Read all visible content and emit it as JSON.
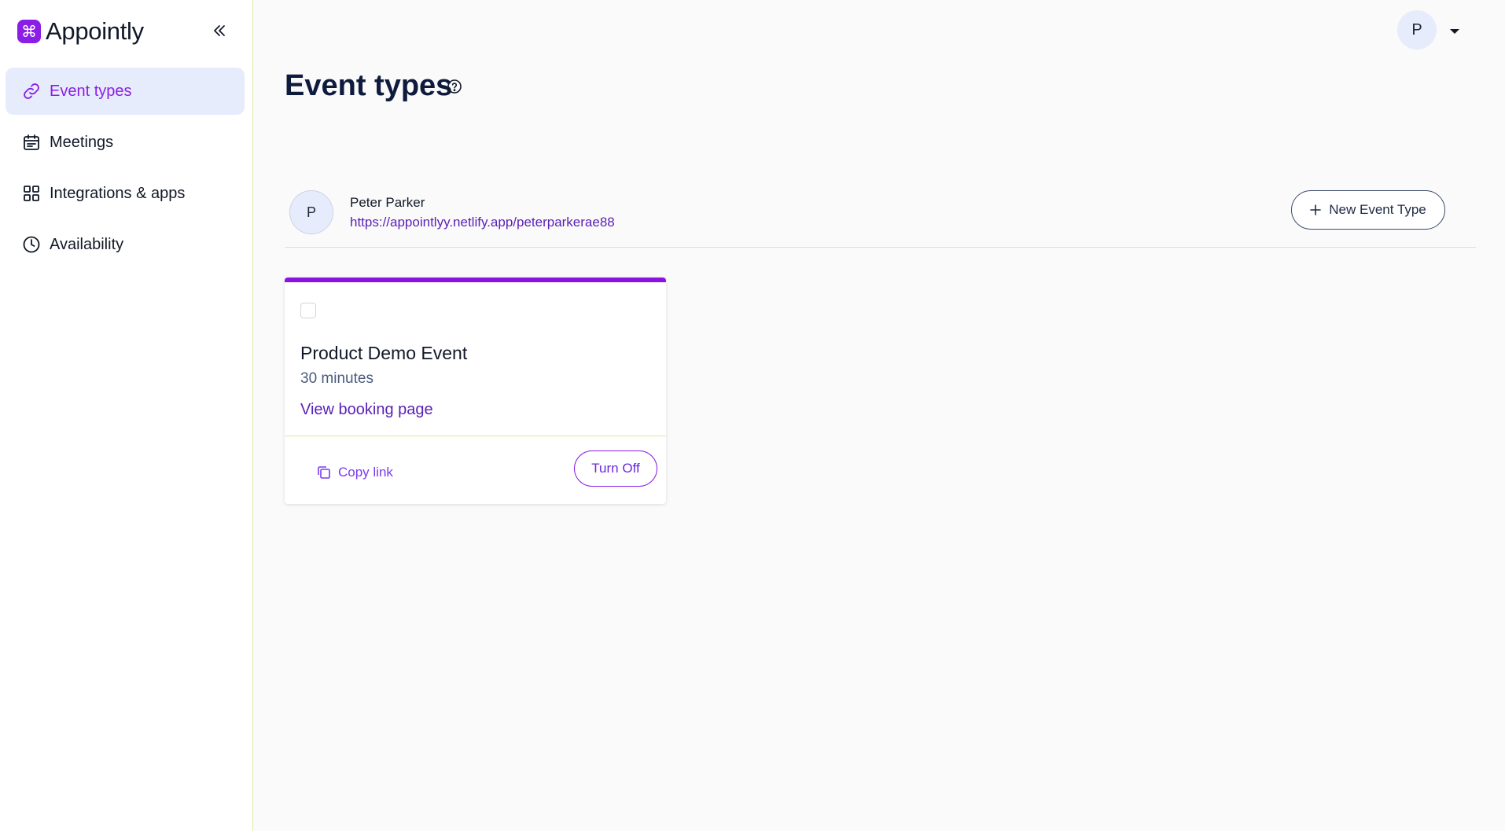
{
  "brand": {
    "name": "Appointly",
    "logo_glyph": "⌘",
    "accent": "#8b1ee6"
  },
  "sidebar": {
    "collapse_icon": "double-chevron-left-icon",
    "items": [
      {
        "label": "Event types",
        "icon": "link-icon",
        "active": true
      },
      {
        "label": "Meetings",
        "icon": "calendar-icon",
        "active": false
      },
      {
        "label": "Integrations & apps",
        "icon": "grid-icon",
        "active": false
      },
      {
        "label": "Availability",
        "icon": "clock-icon",
        "active": false
      }
    ]
  },
  "header": {
    "avatar_initial": "P",
    "menu_icon": "caret-down-icon"
  },
  "page": {
    "title": "Event types",
    "help_icon": "question-circle-icon"
  },
  "owner": {
    "initial": "P",
    "name": "Peter Parker",
    "link": "https://appointlyy.netlify.app/peterparkerae88",
    "new_event_label": "New Event Type"
  },
  "event_cards": [
    {
      "title": "Product Demo Event",
      "duration": "30 minutes",
      "view_label": "View booking page",
      "copy_label": "Copy link",
      "toggle_label": "Turn Off",
      "top_color": "#8b12e0"
    }
  ]
}
